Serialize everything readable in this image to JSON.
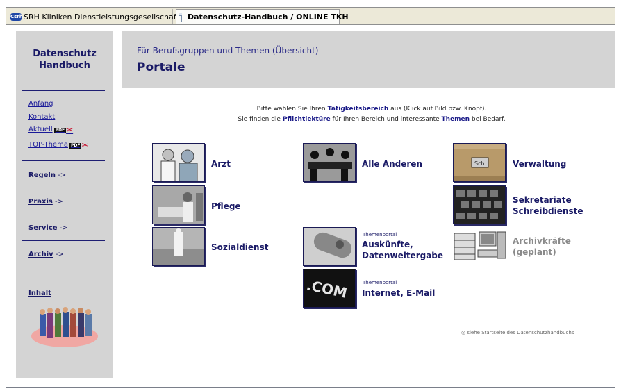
{
  "tabs": [
    {
      "icon": "srh-favicon",
      "icon_text": "Сsrh",
      "label": "SRH Kliniken Dienstleistungsgesellschaft |"
    },
    {
      "icon": "document-icon",
      "label": "Datenschutz-Handbuch / ONLINE TKH"
    }
  ],
  "sidebar": {
    "title_line1": "Datenschutz",
    "title_line2": "Handbuch",
    "links": {
      "anfang": "Anfang",
      "kontakt": "Kontakt",
      "aktuell": "Aktuell",
      "top_thema": "TOP-Thema",
      "pdf": "PDF"
    },
    "nav": {
      "regeln": "Regeln",
      "praxis": "Praxis",
      "service": "Service",
      "archiv": "Archiv",
      "arrow": "->",
      "inhalt": "Inhalt"
    }
  },
  "header": {
    "subtitle": "Für Berufsgruppen und Themen (Übersicht)",
    "title": "Portale"
  },
  "instructions": {
    "line1_pre": "Bitte wählen Sie Ihren ",
    "line1_bold": "Tätigkeitsbereich",
    "line1_post": " aus (Klick auf Bild bzw. Knopf).",
    "line2_pre": "Sie finden die ",
    "line2_bold1": "Pflichtlektüre",
    "line2_mid": " für Ihren Bereich und interessante ",
    "line2_bold2": "Themen",
    "line2_post": " bei Bedarf."
  },
  "portals": {
    "arzt": "Arzt",
    "pflege": "Pflege",
    "sozialdienst": "Sozialdienst",
    "alle_anderen": "Alle Anderen",
    "themenportal": "Themenportal",
    "auskuenfte_1": "Auskünfte,",
    "auskuenfte_2": "Datenweitergabe",
    "internet": "Internet, E-Mail",
    "com_text": ".COM",
    "verwaltung": "Verwaltung",
    "sch_text": "Sch",
    "sekretariate_1": "Sekretariate",
    "sekretariate_2": "Schreibdienste",
    "archiv_1": "Archivkräfte",
    "archiv_2": "(geplant)"
  },
  "footer": "◎ siehe Startseite des Datenschutzhandbuchs",
  "colors": {
    "navy": "#1a1a66",
    "panel_gray": "#d4d4d4",
    "disabled_gray": "#8a8a8a"
  }
}
